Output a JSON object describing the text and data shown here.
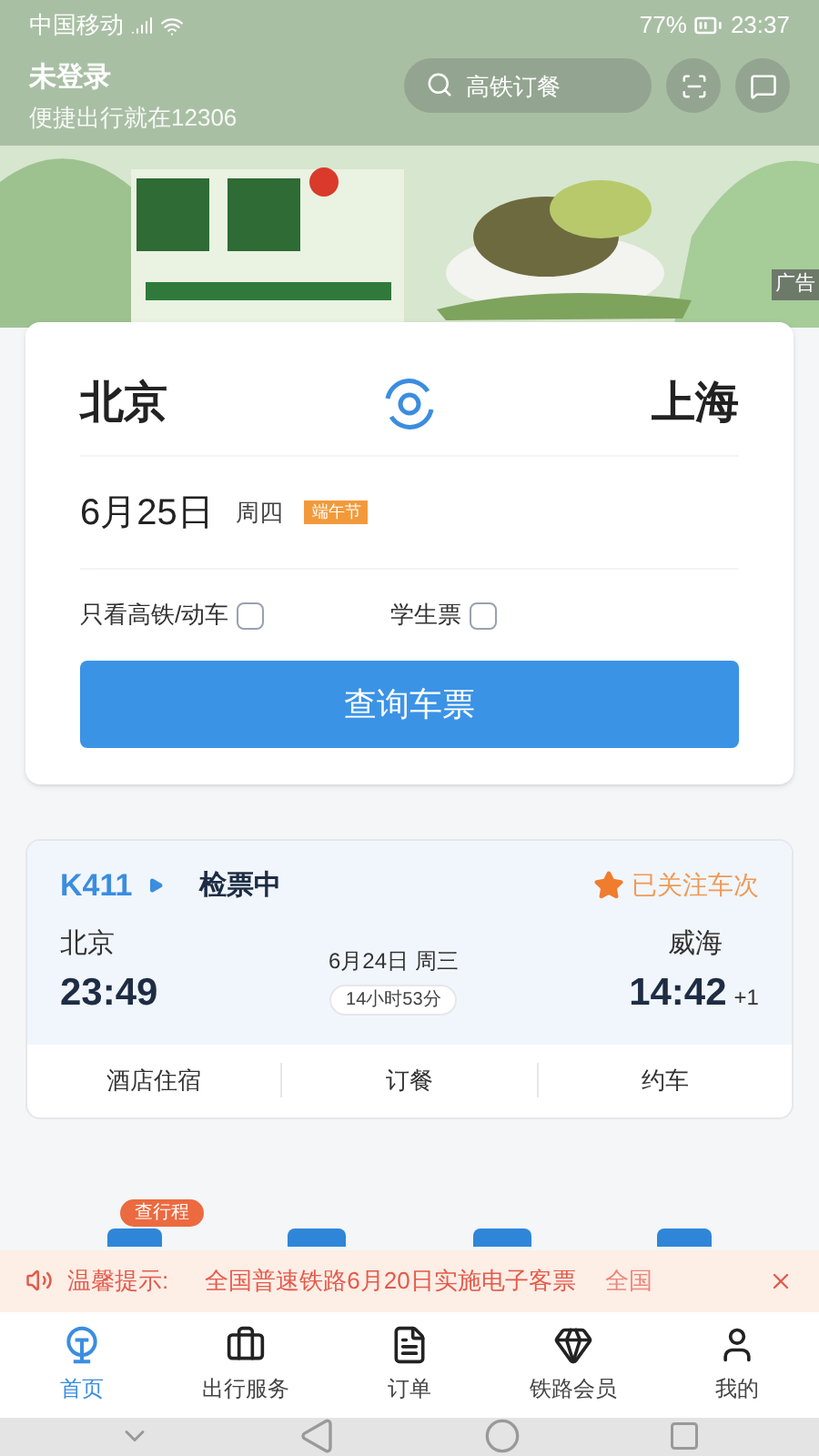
{
  "status_bar": {
    "carrier": "中国移动",
    "battery": "77%",
    "time": "23:37"
  },
  "header": {
    "title": "未登录",
    "subtitle": "便捷出行就在12306",
    "search": {
      "placeholder": "高铁订餐"
    }
  },
  "banner": {
    "ad_label": "广告"
  },
  "search_card": {
    "from": "北京",
    "to": "上海",
    "date": "6月25日",
    "weekday": "周四",
    "holiday_tag": "端午节",
    "options": [
      {
        "label": "只看高铁/动车",
        "checked": false
      },
      {
        "label": "学生票",
        "checked": false
      }
    ],
    "button": "查询车票"
  },
  "trip_card": {
    "train": "K411",
    "status": "检票中",
    "follow": "已关注车次",
    "from": "北京",
    "depart": "23:49",
    "date": "6月24日 周三",
    "duration": "14小时53分",
    "to": "威海",
    "arrive": "14:42",
    "day_offset": "+1",
    "actions": [
      "酒店住宿",
      "订餐",
      "约车"
    ]
  },
  "shortcut_badge": "查行程",
  "notice": {
    "label": "温馨提示:",
    "message": "全国普速铁路6月20日实施电子客票",
    "message_cut": "全国"
  },
  "tab_bar": [
    {
      "label": "首页",
      "selected": true
    },
    {
      "label": "出行服务",
      "selected": false
    },
    {
      "label": "订单",
      "selected": false
    },
    {
      "label": "铁路会员",
      "selected": false
    },
    {
      "label": "我的",
      "selected": false
    }
  ]
}
